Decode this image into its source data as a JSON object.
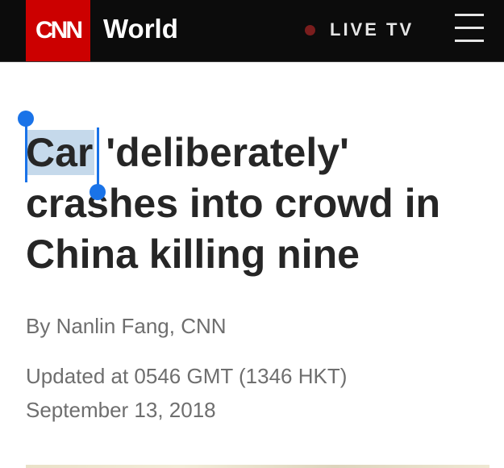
{
  "header": {
    "logo_text": "CNN",
    "section_title": "World",
    "live_label": "LIVE TV",
    "live_dot_color": "#7a1d1d",
    "brand_color": "#cc0000",
    "menu_icon": "hamburger-menu-icon"
  },
  "article": {
    "headline_selected": "Car",
    "headline_line1_rest": " 'deliberately'",
    "headline_line2": "crashes into crowd in",
    "headline_line3": "China killing nine",
    "byline": "By Nanlin Fang, CNN",
    "updated": "Updated at 0546 GMT (1346 HKT)",
    "date": "September 13, 2018"
  },
  "selection": {
    "highlight_color": "#c5d9eb",
    "handle_color": "#1a73e8"
  }
}
